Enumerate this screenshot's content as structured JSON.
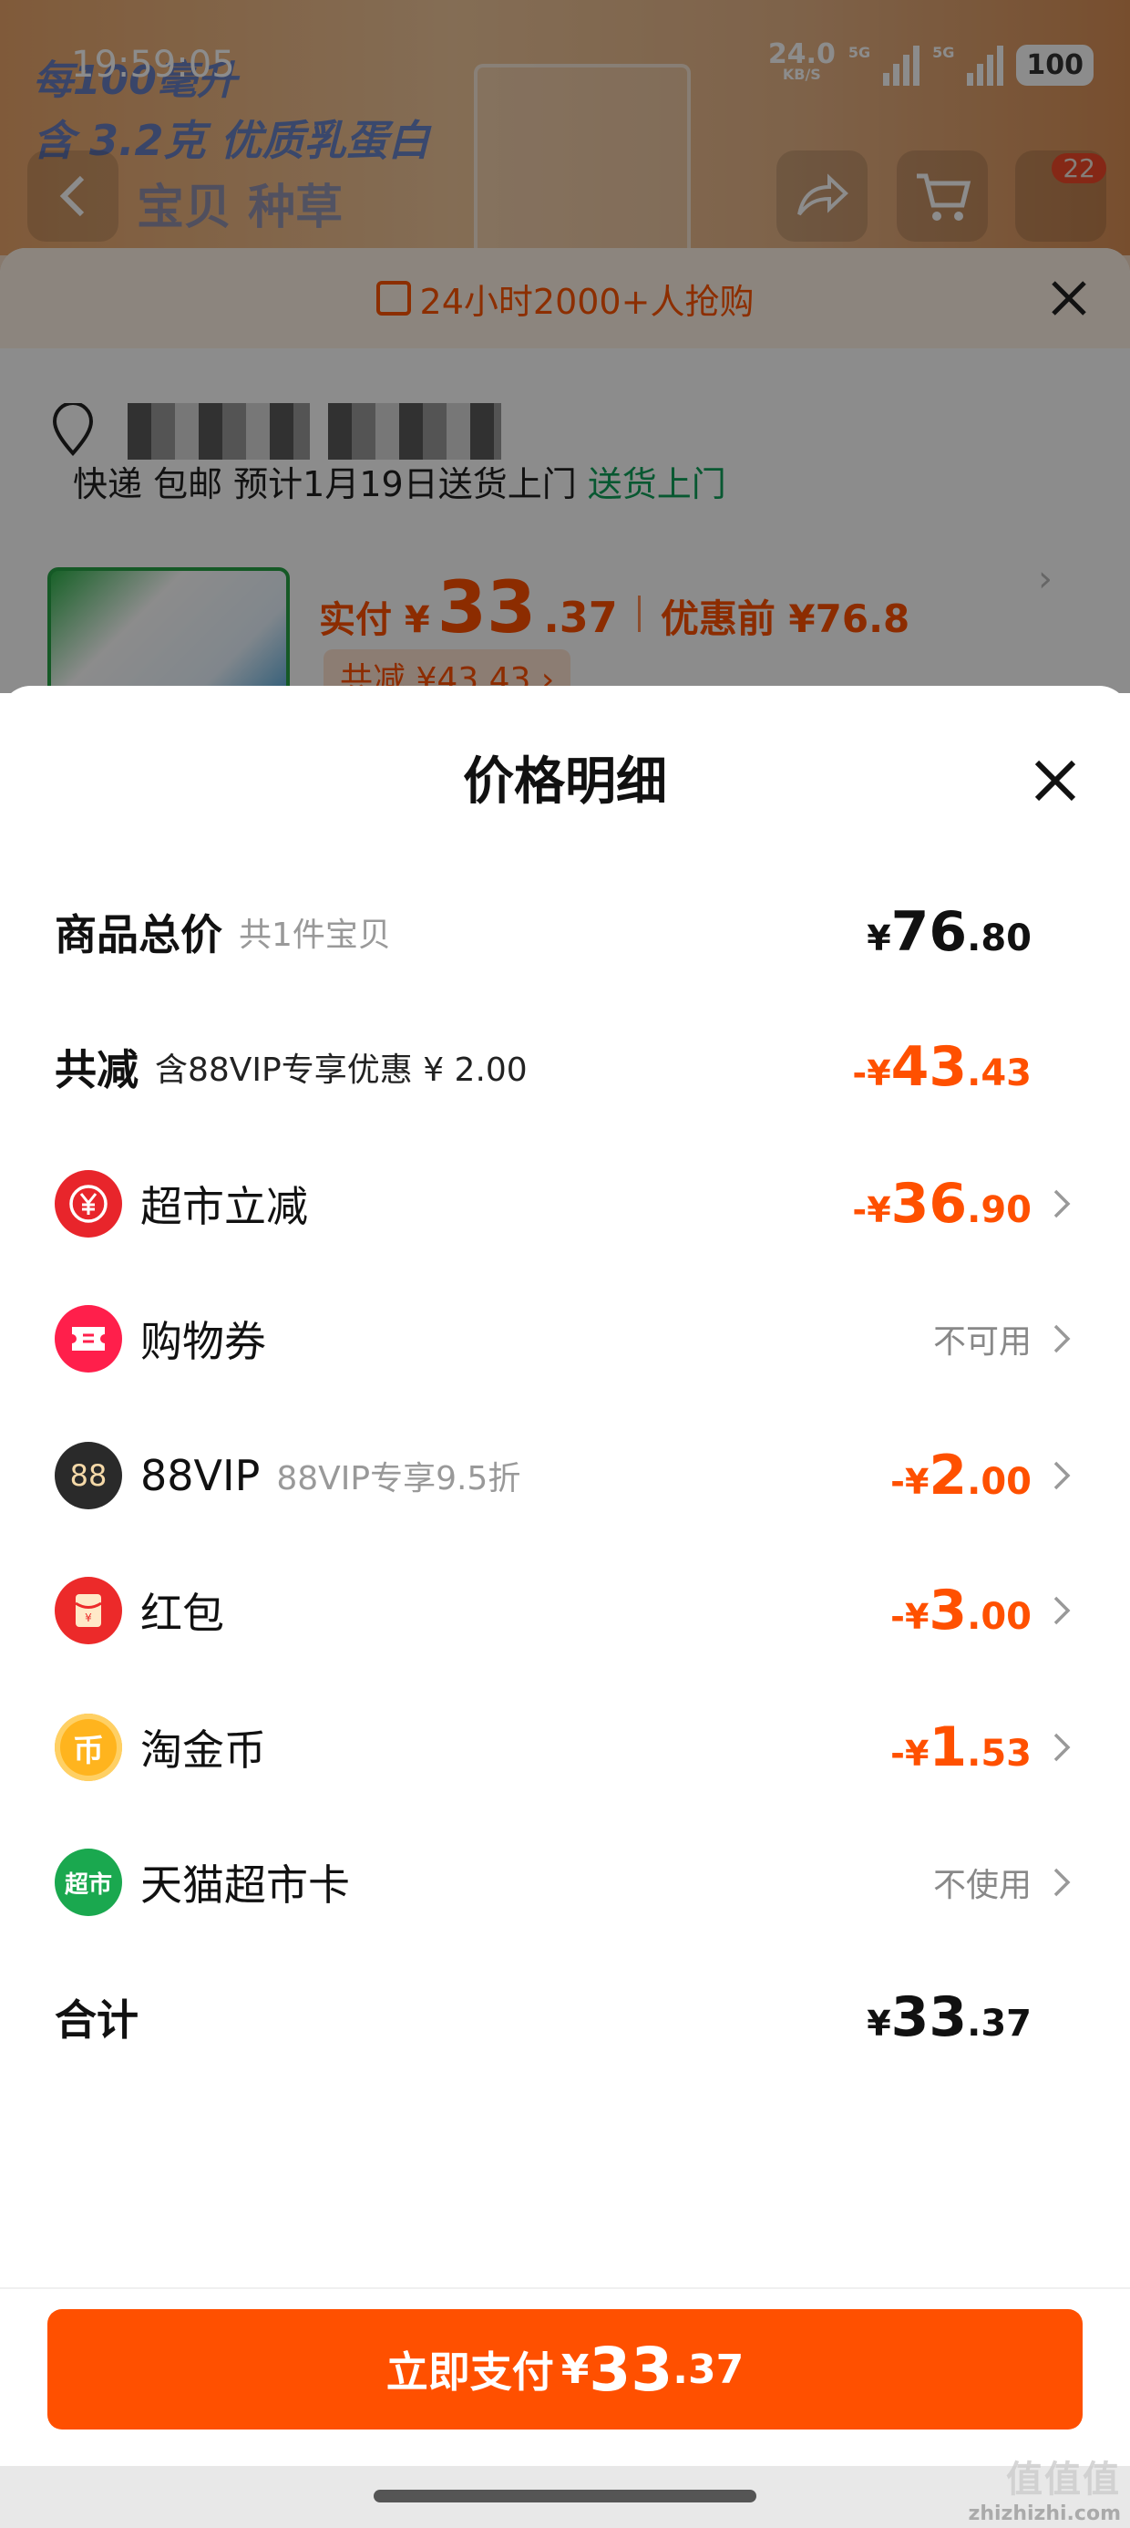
{
  "status_bar": {
    "time": "19:59:05",
    "net_speed_value": "24.0",
    "net_speed_unit": "KB/S",
    "sim1": "5G",
    "sim2": "5G",
    "battery": "100"
  },
  "background": {
    "hero_line1": "每100毫升",
    "hero_line2": "含 3.2克 优质乳蛋白",
    "nav_title": "宝贝 种草",
    "cart_badge": "22",
    "promo_banner": "24小时2000+人抢购",
    "shipping_prefix": "快递 包邮 预计1月19日送货上门",
    "shipping_tag": "送货上门",
    "pay_label": "实付 ¥",
    "pay_int": "33",
    "pay_dec": ".37",
    "pre_discount": "优惠前 ¥76.8",
    "total_save": "共减 ¥43.43 ›"
  },
  "sheet": {
    "title": "价格明细",
    "rows": [
      {
        "label": "商品总价",
        "sub": "共1件宝贝",
        "yen": "¥",
        "int": "76",
        "dec": ".80",
        "color": "#111111"
      },
      {
        "label": "共减",
        "sub": "含88VIP专享优惠 ¥ 2.00",
        "yen": "-¥",
        "int": "43",
        "dec": ".43",
        "color": "#ff5000"
      },
      {
        "label": "超市立减",
        "icon": "yuan-tag-icon",
        "yen": "-¥",
        "int": "36",
        "dec": ".90",
        "color": "#ff5000"
      },
      {
        "label": "购物券",
        "icon": "ticket-icon",
        "status": "不可用"
      },
      {
        "label": "88VIP",
        "sub": "88VIP专享9.5折",
        "icon": "vip88-icon",
        "icon_text": "88",
        "yen": "-¥",
        "int": "2",
        "dec": ".00",
        "color": "#ff5000"
      },
      {
        "label": "红包",
        "icon": "red-packet-icon",
        "yen": "-¥",
        "int": "3",
        "dec": ".00",
        "color": "#ff5000"
      },
      {
        "label": "淘金币",
        "icon": "gold-coin-icon",
        "icon_text": "币",
        "yen": "-¥",
        "int": "1",
        "dec": ".53",
        "color": "#ff5000"
      },
      {
        "label": "天猫超市卡",
        "icon": "tmall-card-icon",
        "icon_text": "超市",
        "status": "不使用"
      },
      {
        "label": "合计",
        "yen": "¥",
        "int": "33",
        "dec": ".37",
        "color": "#111111"
      }
    ]
  },
  "pay_button": {
    "label": "立即支付",
    "yen": "¥",
    "int": "33",
    "dec": ".37"
  },
  "watermark": {
    "brand": "值值值",
    "domain": "zhizhizhi.com"
  },
  "colors": {
    "accent": "#ff5000",
    "green": "#10a05a"
  }
}
